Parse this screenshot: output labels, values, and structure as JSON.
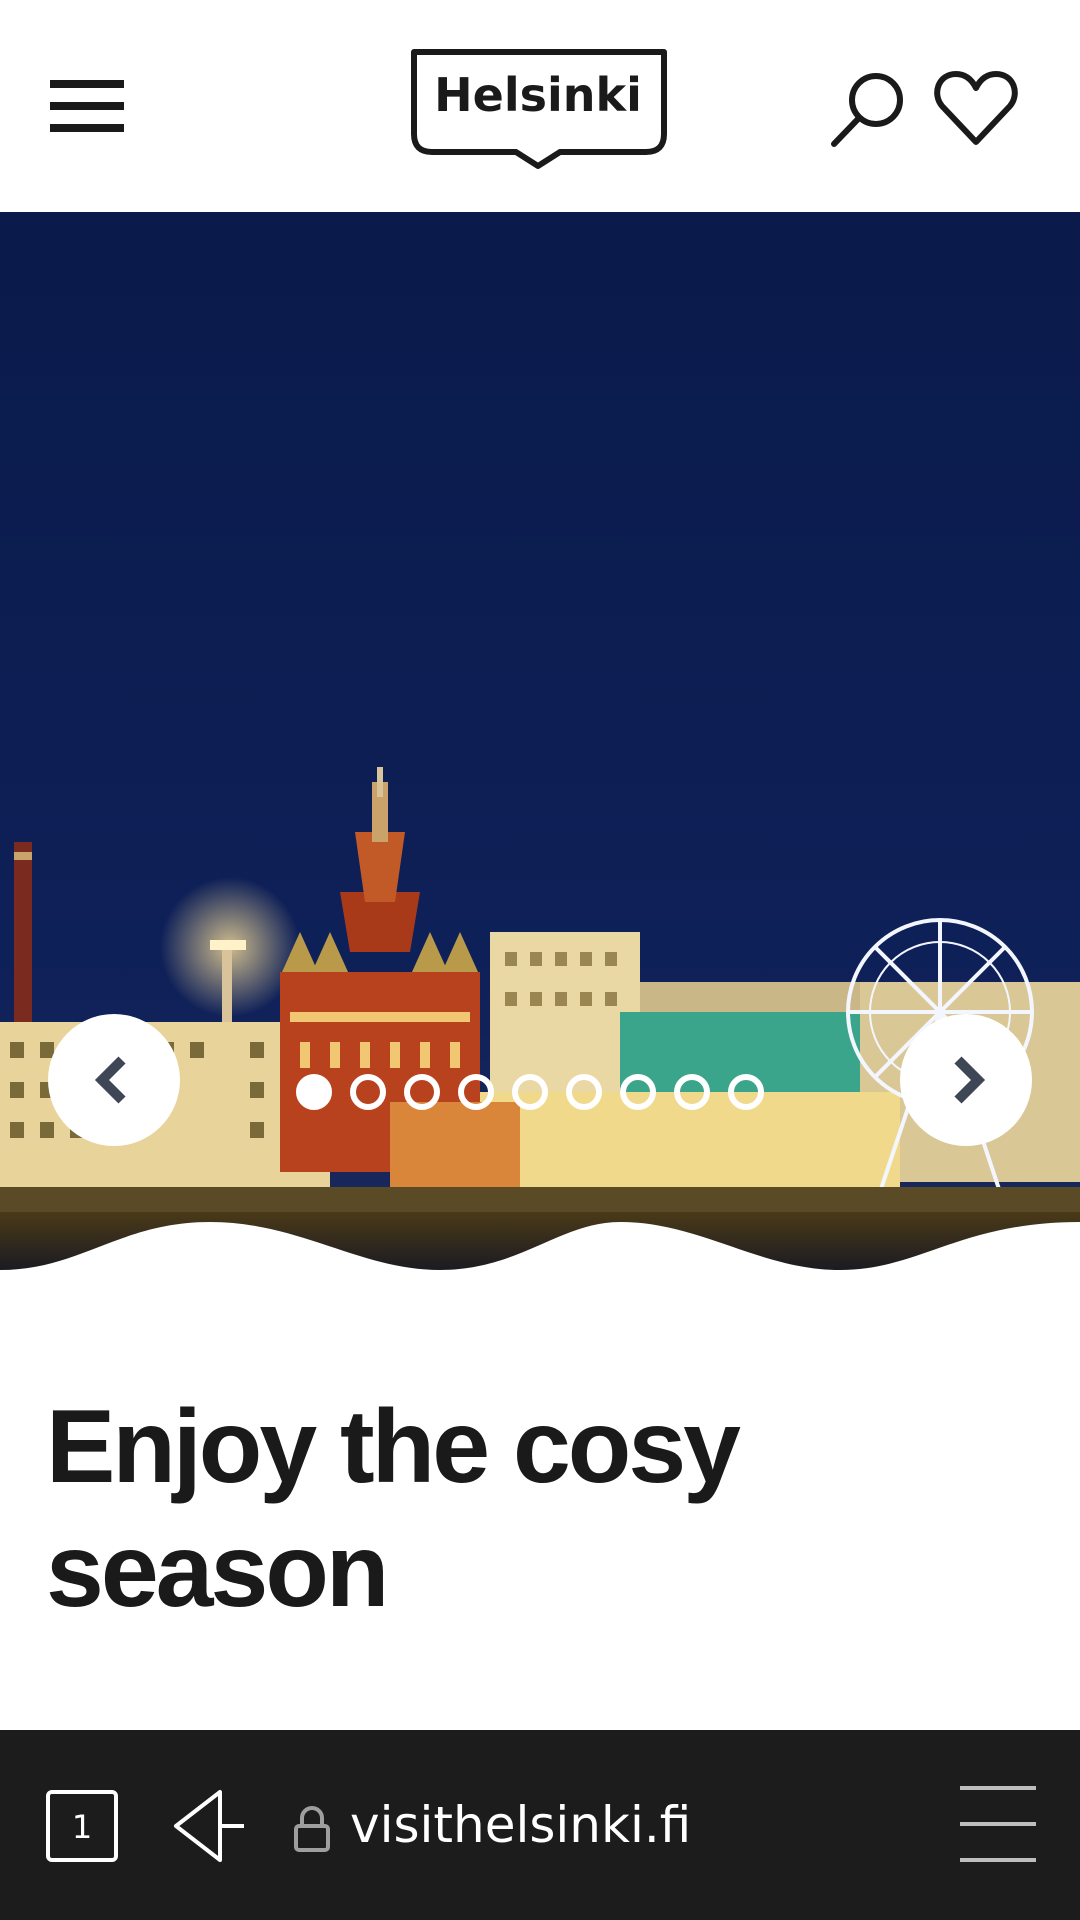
{
  "header": {
    "logo_text": "Helsinki",
    "menu_icon": "hamburger-menu-icon",
    "search_icon": "search-icon",
    "favorites_icon": "heart-icon"
  },
  "hero": {
    "image_subject": "Helsinki harbour at night with Uspenski Cathedral and SkyWheel",
    "carousel": {
      "slide_count": 9,
      "active_index": 0,
      "prev_icon": "chevron-left-icon",
      "next_icon": "chevron-right-icon"
    }
  },
  "main": {
    "heading": "Enjoy the cosy season"
  },
  "browser": {
    "tab_count": "1",
    "url": "visithelsinki.fi",
    "back_icon": "back-arrow-icon",
    "lock_icon": "lock-icon",
    "menu_icon": "browser-menu-icon"
  },
  "colors": {
    "sky": "#0c1c4f",
    "text": "#1a1a1a",
    "browser_bar": "#1c1c1c",
    "arrow_chevron": "#3f4757"
  }
}
